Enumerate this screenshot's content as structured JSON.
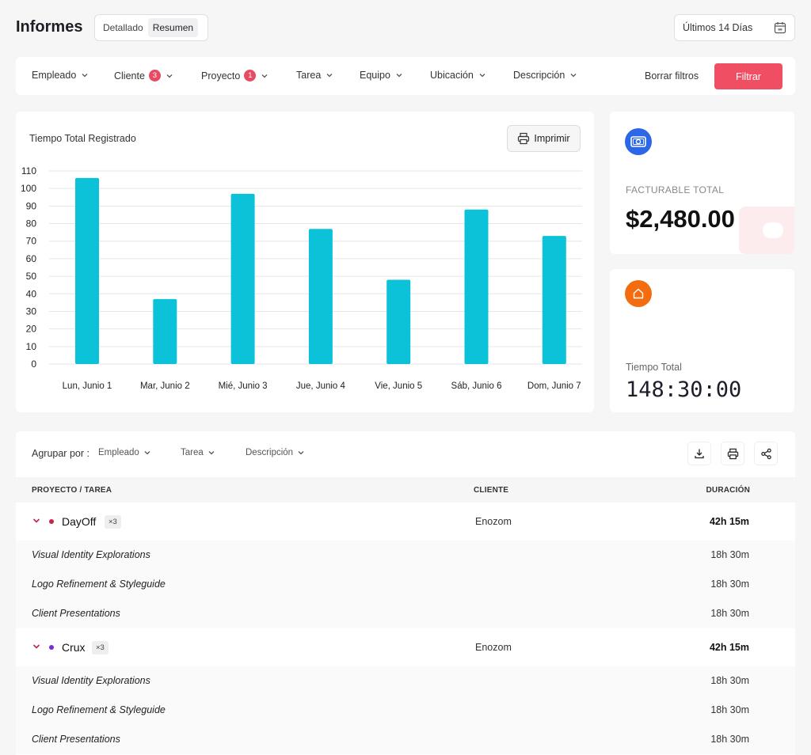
{
  "header": {
    "title": "Informes",
    "view_options": [
      "Detallado",
      "Resumen"
    ],
    "active_view": "Resumen",
    "date_range": "Últimos 14 Días"
  },
  "filters": {
    "items": [
      {
        "label": "Empleado",
        "badge": null
      },
      {
        "label": "Cliente",
        "badge": "3"
      },
      {
        "label": "Proyecto",
        "badge": "1"
      },
      {
        "label": "Tarea",
        "badge": null
      },
      {
        "label": "Equipo",
        "badge": null
      },
      {
        "label": "Ubicación",
        "badge": null
      },
      {
        "label": "Descripción",
        "badge": null
      }
    ],
    "clear_label": "Borrar filtros",
    "apply_label": "Filtrar"
  },
  "chart_panel": {
    "print_label": "Imprimir"
  },
  "chart_data": {
    "type": "bar",
    "title": "Tiempo Total Registrado",
    "categories": [
      "Lun, Junio 1",
      "Mar, Junio 2",
      "Mié, Junio 3",
      "Jue, Junio 4",
      "Vie, Junio 5",
      "Sáb, Junio 6",
      "Dom, Junio 7"
    ],
    "values": [
      106,
      37,
      97,
      77,
      48,
      88,
      73
    ],
    "ylim": [
      0,
      110
    ],
    "yticks": [
      0,
      10,
      20,
      30,
      40,
      50,
      60,
      70,
      80,
      90,
      100,
      110
    ],
    "grid": true,
    "color": "#0cc2d8"
  },
  "stats": {
    "billable": {
      "label": "FACTURABLE TOTAL",
      "value": "$2,480.00",
      "icon": "money-icon",
      "color": "#2b67e6"
    },
    "time": {
      "label": "Tiempo Total",
      "value": "148:30:00",
      "icon": "home-icon",
      "color": "#f36c10"
    }
  },
  "table": {
    "group_by_label": "Agrupar por :",
    "group_options": [
      "Empleado",
      "Tarea",
      "Descripción"
    ],
    "columns": [
      "PROYECTO / TAREA",
      "CLIENTE",
      "DURACIÓN"
    ],
    "projects": [
      {
        "name": "DayOff",
        "dot_color": "#c8234a",
        "count": "×3",
        "client": "Enozom",
        "duration": "42h 15m",
        "tasks": [
          {
            "name": "Visual Identity Explorations",
            "duration": "18h 30m"
          },
          {
            "name": "Logo Refinement & Styleguide",
            "duration": "18h 30m"
          },
          {
            "name": "Client Presentations",
            "duration": "18h 30m"
          }
        ]
      },
      {
        "name": "Crux",
        "dot_color": "#7a2bd4",
        "count": "×3",
        "client": "Enozom",
        "duration": "42h 15m",
        "tasks": [
          {
            "name": "Visual Identity Explorations",
            "duration": "18h 30m"
          },
          {
            "name": "Logo Refinement & Styleguide",
            "duration": "18h 30m"
          },
          {
            "name": "Client Presentations",
            "duration": "18h 30m"
          }
        ]
      }
    ]
  }
}
